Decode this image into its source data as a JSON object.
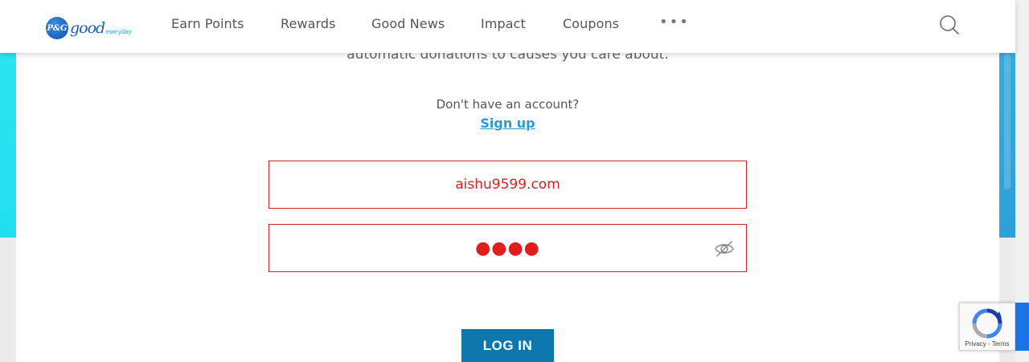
{
  "header": {
    "logo_pg": "P&G",
    "logo_good": "good",
    "logo_everyday": "everyday",
    "nav": [
      {
        "label": "Earn Points"
      },
      {
        "label": "Rewards"
      },
      {
        "label": "Good News"
      },
      {
        "label": "Impact"
      },
      {
        "label": "Coupons"
      }
    ],
    "more": "•••"
  },
  "content": {
    "cutoff_text": "automatic donations to causes you care about.",
    "no_account": "Don't have an account?",
    "signup": "Sign up",
    "email_value": "aishu9599.com",
    "password_masked": "●●●●",
    "login_button": "LOG IN"
  },
  "recaptcha": {
    "links": "Privacy - Terms"
  },
  "colors": {
    "accent": "#0d76ad",
    "link": "#2b9ad0",
    "error": "#d32323"
  }
}
